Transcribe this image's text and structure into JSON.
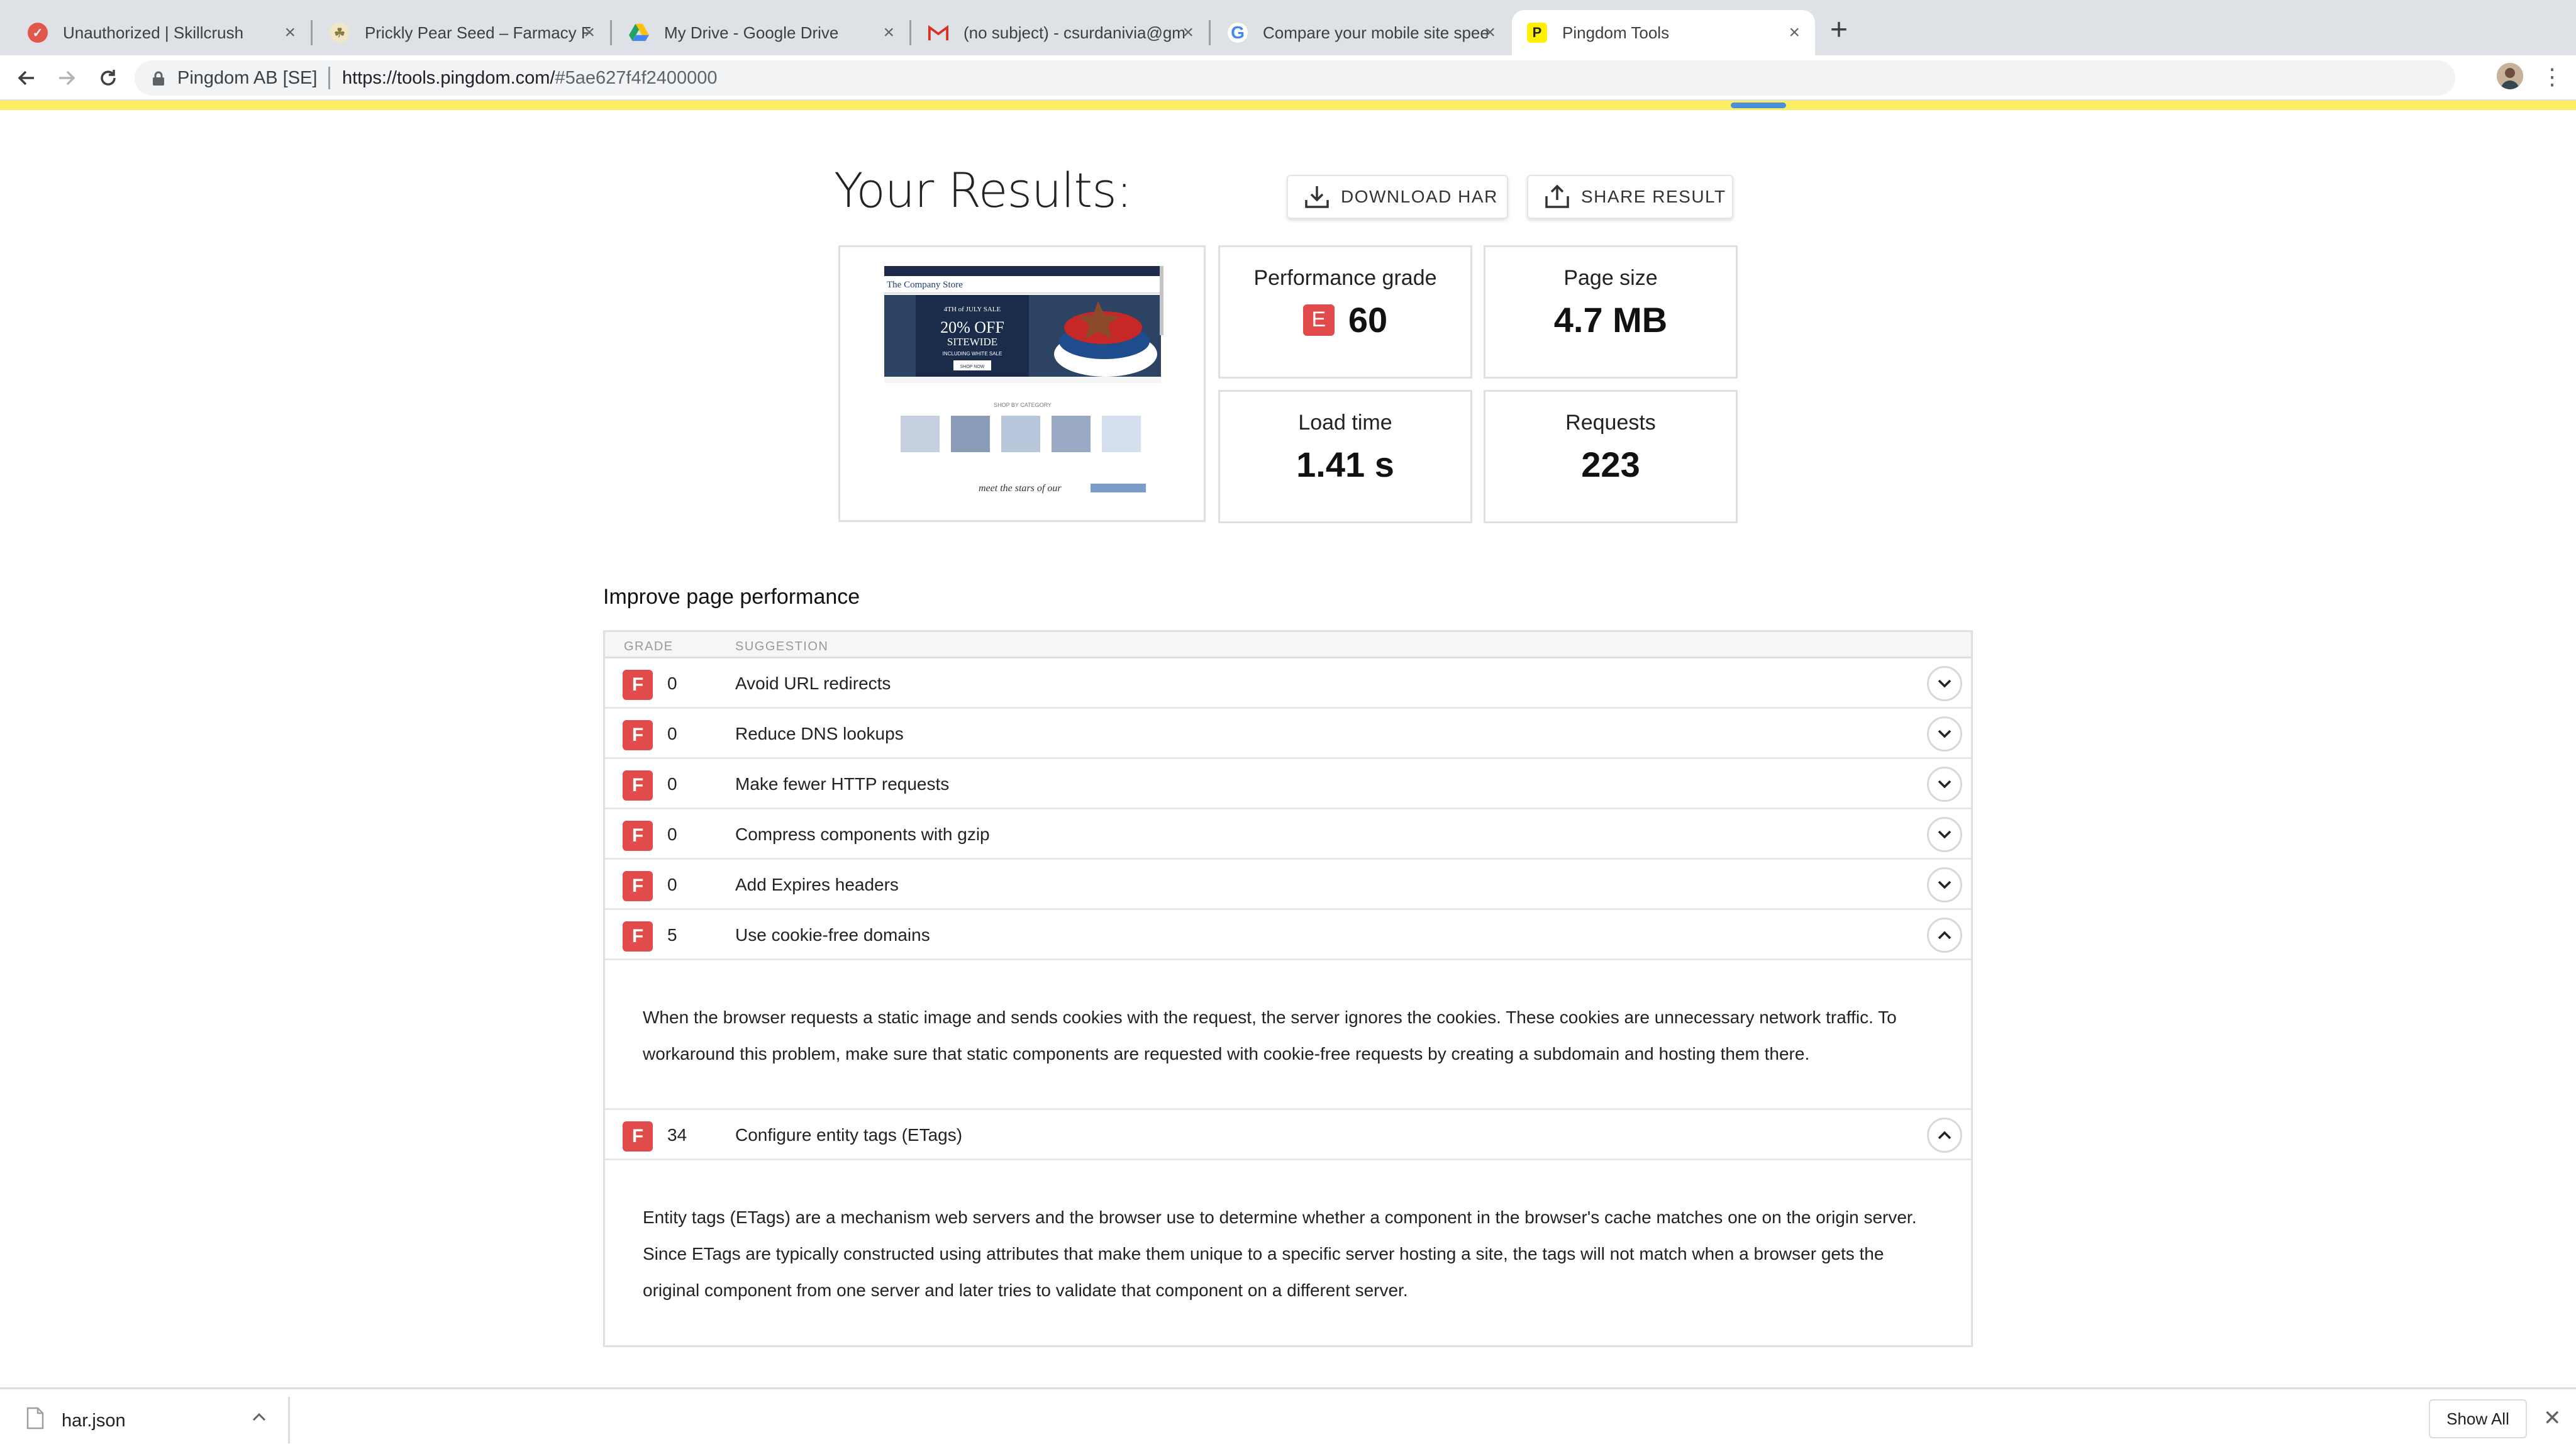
{
  "browser": {
    "tabs": [
      {
        "title": "Unauthorized | Skillcrush",
        "favicon": "skillcrush-icon",
        "color": "#e2574c"
      },
      {
        "title": "Prickly Pear Seed – Farmacy Fa",
        "favicon": "farmacy-icon",
        "color": "#c8b560"
      },
      {
        "title": "My Drive - Google Drive",
        "favicon": "google-drive-icon",
        "color": "#1fa463"
      },
      {
        "title": "(no subject) - csurdanivia@gm",
        "favicon": "gmail-icon",
        "color": "#d93025"
      },
      {
        "title": "Compare your mobile site spee",
        "favicon": "google-icon",
        "color": "#4285f4"
      },
      {
        "title": "Pingdom Tools",
        "favicon": "pingdom-icon",
        "color": "#fff000",
        "active": true
      }
    ],
    "new_tab_label": "+",
    "site_identity": "Pingdom AB [SE]",
    "url_domain": "https://tools.pingdom.com/",
    "url_hash": "#5ae627f4f2400000"
  },
  "results": {
    "title": "Your Results:",
    "download_har_label": "DOWNLOAD HAR",
    "share_result_label": "SHARE RESULT",
    "performance_grade_label": "Performance grade",
    "performance_grade_letter": "E",
    "performance_grade_value": "60",
    "page_size_label": "Page size",
    "page_size_value": "4.7 MB",
    "load_time_label": "Load time",
    "load_time_value": "1.41 s",
    "requests_label": "Requests",
    "requests_value": "223"
  },
  "site_preview": {
    "logo": "The Company Store",
    "banner_small": "4TH of JULY SALE",
    "banner_main": "20% OFF",
    "banner_sub": "SITEWIDE",
    "banner_note": "INCLUDING WHITE SALE",
    "shop_button": "SHOP NOW",
    "category_heading": "SHOP BY CATEGORY",
    "tagline": "meet the stars of our"
  },
  "improve": {
    "title": "Improve page performance",
    "col_grade": "GRADE",
    "col_suggestion": "SUGGESTION",
    "rows": [
      {
        "grade": "F",
        "score": "0",
        "suggestion": "Avoid URL redirects"
      },
      {
        "grade": "F",
        "score": "0",
        "suggestion": "Reduce DNS lookups"
      },
      {
        "grade": "F",
        "score": "0",
        "suggestion": "Make fewer HTTP requests"
      },
      {
        "grade": "F",
        "score": "0",
        "suggestion": "Compress components with gzip"
      },
      {
        "grade": "F",
        "score": "0",
        "suggestion": "Add Expires headers"
      },
      {
        "grade": "F",
        "score": "5",
        "suggestion": "Use cookie-free domains"
      },
      {
        "grade": "F",
        "score": "34",
        "suggestion": "Configure entity tags (ETags)"
      }
    ],
    "cookie_detail": "When the browser requests a static image and sends cookies with the request, the server ignores the cookies. These cookies are unnecessary network traffic. To workaround this problem, make sure that static components are requested with cookie-free requests by creating a subdomain and hosting them there.",
    "etags_detail": "Entity tags (ETags) are a mechanism web servers and the browser use to determine whether a component in the browser's cache matches one on the origin server. Since ETags are typically constructed using attributes that make them unique to a specific server hosting a site, the tags will not match when a browser gets the original component from one server and later tries to validate that component on a different server."
  },
  "downloads": {
    "file_name": "har.json",
    "show_all_label": "Show All"
  },
  "colors": {
    "grade_red": "#e24b4b",
    "pingdom_yellow": "#fbef61",
    "tab_bar": "#dee1e6"
  }
}
